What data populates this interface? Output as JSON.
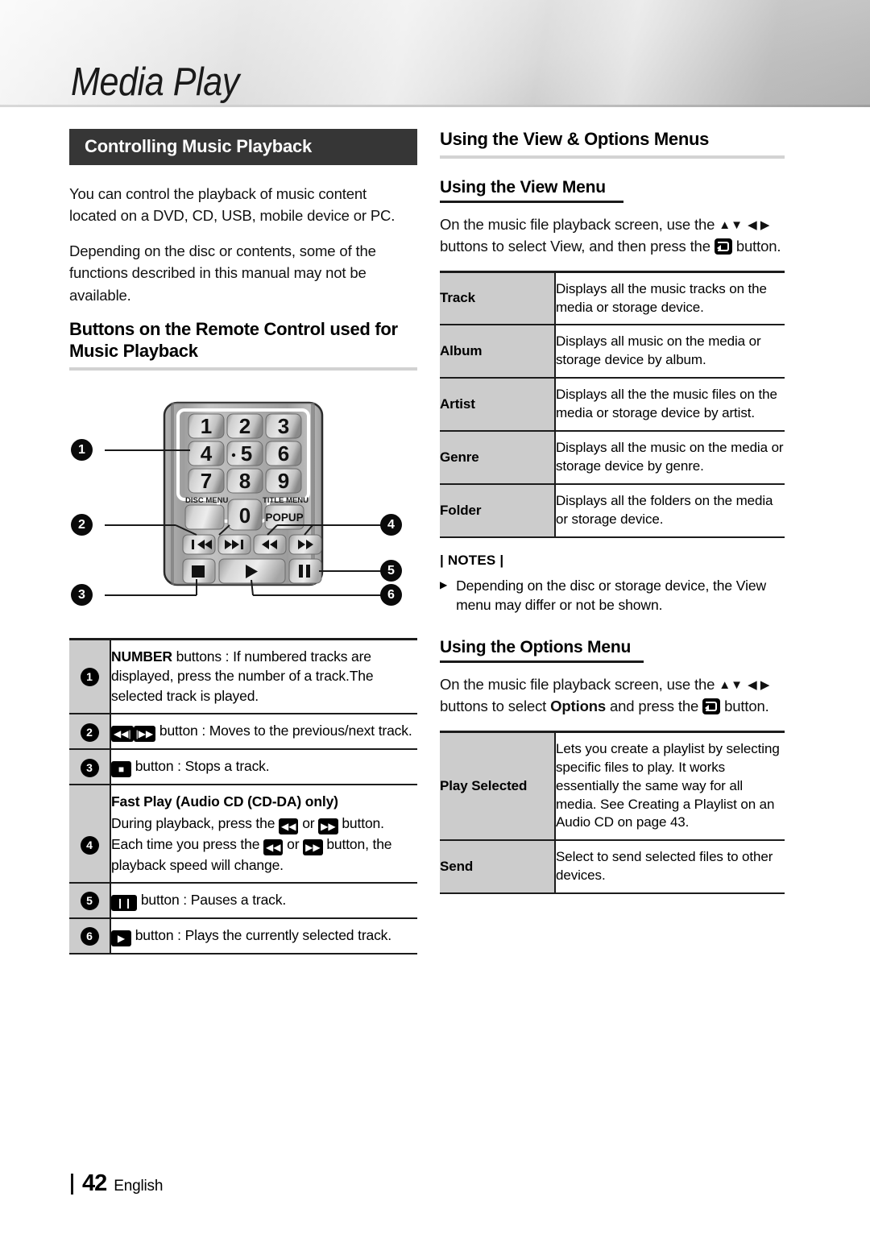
{
  "header": {
    "chapter_title": "Media Play"
  },
  "left": {
    "section_bar": "Controlling Music Playback",
    "intro_p1": "You can control the playback of music content located on a DVD, CD, USB, mobile device or PC.",
    "intro_p2": "Depending on the disc or contents, some of the functions described in this manual may not be available.",
    "heading": "Buttons on the Remote Control used for Music Playback",
    "remote": {
      "keys": [
        "1",
        "2",
        "3",
        "4",
        "5",
        "6",
        "7",
        "8",
        "9",
        "0"
      ],
      "disc_menu_label": "DISC MENU",
      "title_menu_label": "TITLE MENU",
      "popup_label": "POPUP",
      "transport": [
        "prev-track",
        "next-track",
        "rewind",
        "fast-forward",
        "stop",
        "play",
        "pause"
      ],
      "callouts": [
        "1",
        "2",
        "3",
        "4",
        "5",
        "6"
      ]
    },
    "table": [
      {
        "num": "1",
        "parts": [
          {
            "t": "b",
            "v": "NUMBER"
          },
          {
            "t": "n",
            "v": " buttons : If numbered tracks are displayed, press the number of a track.The selected track is played."
          }
        ]
      },
      {
        "num": "2",
        "parts": [
          {
            "t": "k",
            "v": "prev-track"
          },
          {
            "t": "k",
            "v": "next-track"
          },
          {
            "t": "n",
            "v": " button : Moves to the previous/next track."
          }
        ]
      },
      {
        "num": "3",
        "parts": [
          {
            "t": "k",
            "v": "stop"
          },
          {
            "t": "n",
            "v": " button : Stops a track."
          }
        ]
      }
    ],
    "fast_play_title": "Fast Play (Audio CD (CD-DA) only)",
    "fast_play_num": "4",
    "fast_play_lines": [
      "During playback, press the  ◀◀  or  ▶▶  button.",
      "Each time you press the  ◀◀  or  ▶▶  button, the",
      "playback speed will change."
    ],
    "table2": [
      {
        "num": "5",
        "parts": [
          {
            "t": "k",
            "v": "pause"
          },
          {
            "t": "n",
            "v": " button : Pauses a track."
          }
        ]
      },
      {
        "num": "6",
        "parts": [
          {
            "t": "k",
            "v": "play"
          },
          {
            "t": "n",
            "v": " button : Plays the currently selected track."
          }
        ]
      }
    ]
  },
  "right": {
    "major_heading": "Using the View & Options Menus",
    "view_menu": {
      "heading": "Using the View Menu",
      "intro_a": "On the music file playback screen, use the ",
      "intro_b": " buttons to select View, and then press the ",
      "intro_c": " button.",
      "rows": [
        {
          "key": "Track",
          "value": "Displays all the music tracks on the media or storage device."
        },
        {
          "key": "Album",
          "value": "Displays all music on the media or storage device by album."
        },
        {
          "key": "Artist",
          "value": "Displays all the the music files on the media or storage device by artist."
        },
        {
          "key": "Genre",
          "value": "Displays all the music on the media or storage device by genre."
        },
        {
          "key": "Folder",
          "value": "Displays all the folders on the media or storage device."
        }
      ]
    },
    "notes_label": "| NOTES |",
    "notes": [
      "Depending on the disc or storage device, the View menu may differ or not be shown."
    ],
    "options_menu": {
      "heading": "Using the Options Menu",
      "intro_a": "On the music file playback screen, use the ",
      "intro_b": " buttons to select ",
      "intro_bold": "Options",
      "intro_c": " and press the ",
      "intro_d": " button.",
      "rows": [
        {
          "key": "Play Selected",
          "value": "Lets you create a playlist by selecting specific files to play. It works essentially the same way for all media. See Creating a Playlist on an Audio CD on page 43."
        },
        {
          "key": "Send",
          "value": "Select to send selected files to other devices."
        }
      ]
    }
  },
  "footer": {
    "page_number": "42",
    "language": "English"
  },
  "colors": {
    "section_bar_bg": "#363636",
    "table_key_bg": "#cccccc",
    "rule_major": "#d2d2d2",
    "rule_minor": "#1a1a1a",
    "text": "#111111"
  }
}
